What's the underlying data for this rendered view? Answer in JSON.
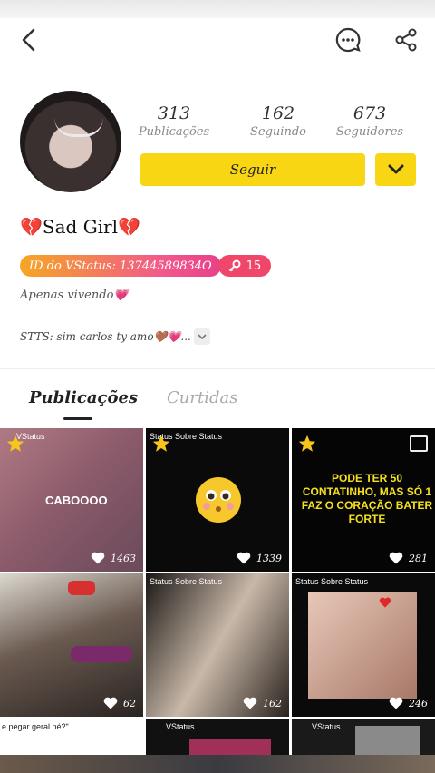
{
  "header": {
    "back": "back-icon",
    "chat": "chat-icon",
    "share": "share-icon"
  },
  "stats": [
    {
      "value": "313",
      "label": "Publicações"
    },
    {
      "value": "162",
      "label": "Seguindo"
    },
    {
      "value": "673",
      "label": "Seguidores"
    }
  ],
  "actions": {
    "follow_label": "Seguir"
  },
  "profile": {
    "name": "💔Sad Girl💔",
    "id_badge": "ID do VStatus: 13744589834O",
    "key_count": "15",
    "bio_line1": "Apenas vivendo💗",
    "bio_line2": "STTS: sim carlos ty amo🤎💗..."
  },
  "tabs": [
    {
      "label": "Publicações"
    },
    {
      "label": "Curtidas"
    }
  ],
  "posts": [
    {
      "likes": "1463",
      "caption": "CABOOOO",
      "watermark": "VStatus"
    },
    {
      "likes": "1339",
      "watermark": "Status Sobre Status"
    },
    {
      "likes": "281",
      "caption": "PODE TER 50 CONTATINHO, MAS SÓ 1 FAZ O CORAÇÃO BATER FORTE"
    },
    {
      "likes": "62"
    },
    {
      "likes": "162",
      "watermark": "Status Sobre Status"
    },
    {
      "likes": "246",
      "watermark": "Status Sobre Status"
    }
  ],
  "partial_row": {
    "caption": "e pegar geral né?\"",
    "wm1": "VStatus",
    "wm2": "VStatus"
  },
  "colors": {
    "accent": "#f8d614",
    "pink": "#f0466a"
  }
}
